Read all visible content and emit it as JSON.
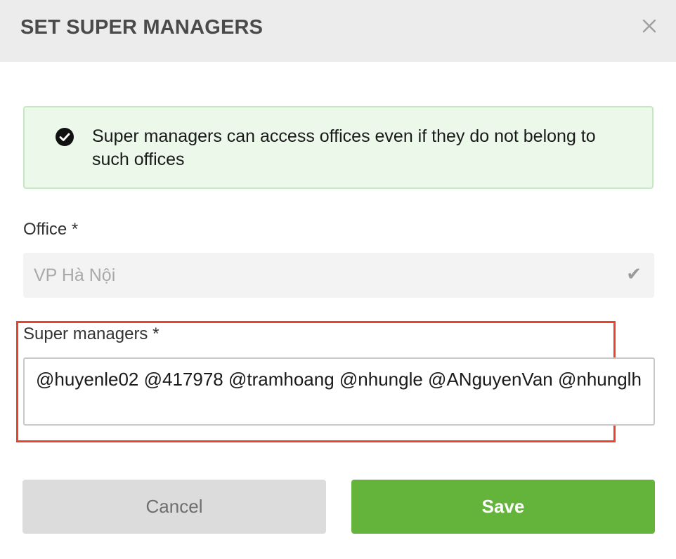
{
  "dialog": {
    "title": "SET SUPER MANAGERS",
    "close_icon": "close-icon"
  },
  "info": {
    "icon": "check-circle-icon",
    "message": "Super managers can access offices even if they do not belong to such offices"
  },
  "office": {
    "label": "Office *",
    "value": "VP Hà Nội",
    "check_glyph": "✔"
  },
  "super_managers": {
    "label": "Super managers *",
    "value": "@huyenle02 @417978 @tramhoang @nhungle @ANguyenVan @nhunglh"
  },
  "buttons": {
    "cancel_label": "Cancel",
    "save_label": "Save"
  },
  "colors": {
    "header_bg": "#ececec",
    "info_bg": "#ebf8ea",
    "info_border": "#c4e9c1",
    "highlight": "#e8432c",
    "save_bg": "#64b43b",
    "cancel_bg": "#dcdcdc"
  }
}
